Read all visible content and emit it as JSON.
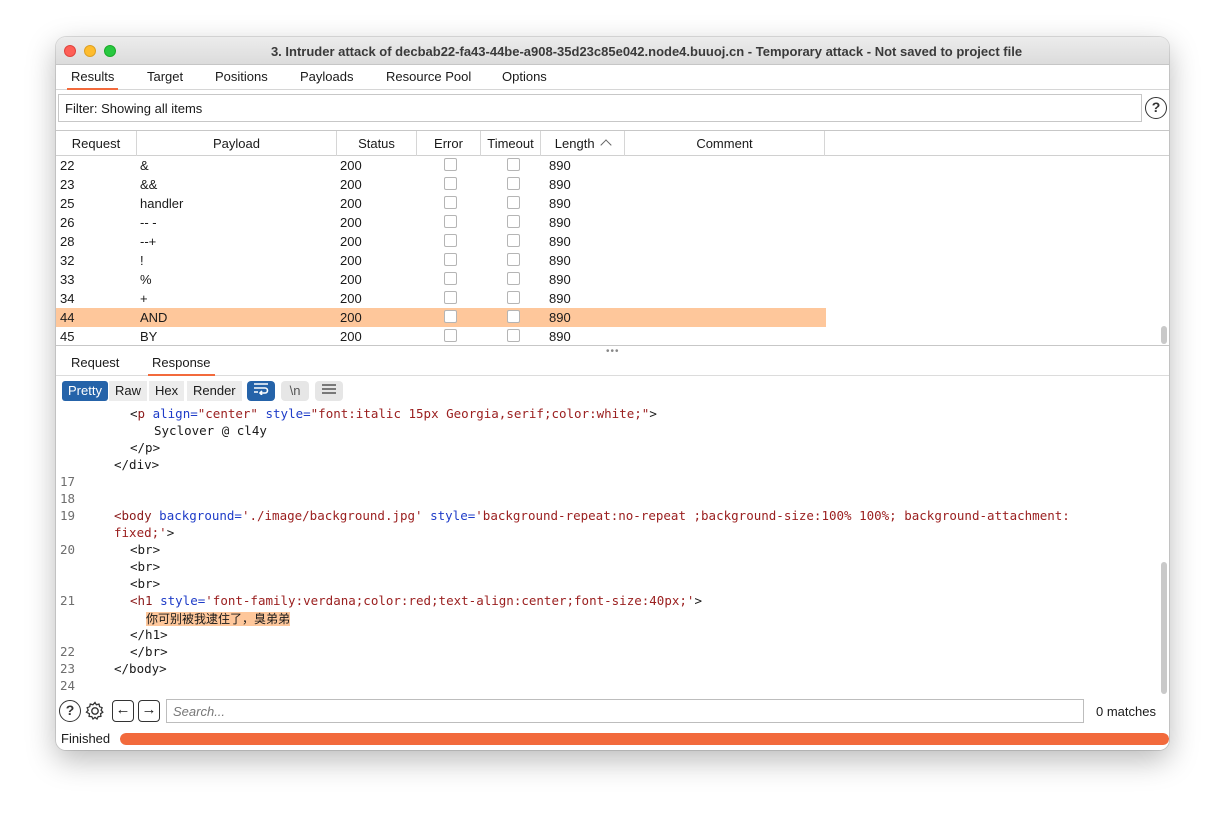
{
  "window": {
    "title": "3. Intruder attack of decbab22-fa43-44be-a908-35d23c85e042.node4.buuoj.cn - Temporary attack - Not saved to project file"
  },
  "tabs": [
    {
      "label": "Results",
      "active": true
    },
    {
      "label": "Target"
    },
    {
      "label": "Positions"
    },
    {
      "label": "Payloads"
    },
    {
      "label": "Resource Pool"
    },
    {
      "label": "Options"
    }
  ],
  "filter": {
    "label": "Filter: Showing all items"
  },
  "help_glyph": "?",
  "table": {
    "columns": [
      "Request",
      "Payload",
      "Status",
      "Error",
      "Timeout",
      "Length",
      "Comment"
    ],
    "sort_indicator": "^",
    "rows": [
      {
        "request": "22",
        "payload": "&",
        "status": "200",
        "length": "890"
      },
      {
        "request": "23",
        "payload": "&&",
        "status": "200",
        "length": "890"
      },
      {
        "request": "25",
        "payload": "handler",
        "status": "200",
        "length": "890"
      },
      {
        "request": "26",
        "payload": "-- -",
        "status": "200",
        "length": "890"
      },
      {
        "request": "28",
        "payload": "--+",
        "status": "200",
        "length": "890"
      },
      {
        "request": "32",
        "payload": "!",
        "status": "200",
        "length": "890"
      },
      {
        "request": "33",
        "payload": "%",
        "status": "200",
        "length": "890"
      },
      {
        "request": "34",
        "payload": "+",
        "status": "200",
        "length": "890"
      },
      {
        "request": "44",
        "payload": "AND",
        "status": "200",
        "length": "890",
        "selected": true
      },
      {
        "request": "45",
        "payload": "BY",
        "status": "200",
        "length": "890"
      }
    ]
  },
  "subtabs": [
    {
      "label": "Request"
    },
    {
      "label": "Response",
      "active": true
    }
  ],
  "view_modes": [
    {
      "label": "Pretty",
      "active": true
    },
    {
      "label": "Raw"
    },
    {
      "label": "Hex"
    },
    {
      "label": "Render"
    }
  ],
  "view_icons": {
    "wrap": "wrap-lines-icon",
    "newline": "\\n",
    "menu": "menu-icon"
  },
  "code": {
    "l1_p_open": "<p",
    "l1_a1": " align=",
    "l1_v1": "\"center\"",
    "l1_a2": " style=",
    "l1_v2": "\"font:italic 15px Georgia,serif;color:white;\"",
    "l1_end": ">",
    "l2_text": "Syclover @ cl4y",
    "l3": "</p>",
    "l4": "</div>",
    "n17": "17",
    "n18": "18",
    "n19": "19",
    "l19_open": "<body",
    "l19_a1": " background=",
    "l19_v1": "'./image/background.jpg'",
    "l19_a2": " style=",
    "l19_v2": "'background-repeat:no-repeat ;background-size:100% 100%; background-attachment:",
    "l19b": "fixed;'",
    "l19b_end": ">",
    "n20": "20",
    "br": "<br>",
    "n21": "21",
    "l21_open": "<h1",
    "l21_a1": " style=",
    "l21_v1": "'font-family:verdana;color:red;text-align:center;font-size:40px;'",
    "l21_end": ">",
    "l21_text": "你可别被我逮住了，臭弟弟",
    "l21_close": "</h1>",
    "n22": "22",
    "l22": "</br>",
    "n23": "23",
    "l23": "</body>",
    "n24": "24"
  },
  "search": {
    "placeholder": "Search...",
    "matches": "0 matches"
  },
  "status": {
    "label": "Finished",
    "progress": 1.0
  },
  "colors": {
    "accent": "#f26a3c",
    "selected_row": "#fec79b",
    "active_view": "#2563a9"
  }
}
